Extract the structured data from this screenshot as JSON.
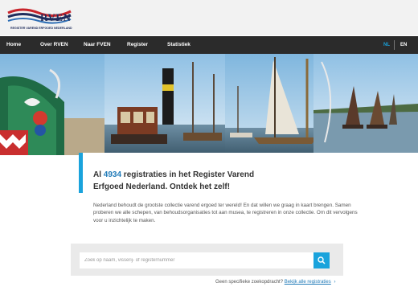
{
  "logo": {
    "wordmark": "RVEN",
    "subtitle": "REGISTER VAREND ERFGOED NEDERLAND"
  },
  "nav": {
    "items": [
      {
        "label": "Home"
      },
      {
        "label": "Over RVEN"
      },
      {
        "label": "Naar FVEN"
      },
      {
        "label": "Register"
      },
      {
        "label": "Statistiek"
      }
    ],
    "languages": [
      {
        "label": "NL",
        "active": true
      },
      {
        "label": "EN",
        "active": false
      }
    ]
  },
  "hero": {
    "panels": [
      "painted-boat-bow",
      "steam-tug-harbor",
      "sailboat-harbor",
      "sailboats-lake"
    ]
  },
  "intro": {
    "headline_prefix": "Al ",
    "registrations_count": "4934",
    "headline_line1_rest": " registraties in het Register Varend",
    "headline_line2": "Erfgoed Nederland. Ontdek het zelf!",
    "body": "Nederland behoudt de grootste collectie varend ergoed ter wereld! En dat willen we graag in kaart brengen. Samen proberen we alle schepen, van behoudsorganisaties tot aan musea, te registreren in onze collectie. Om dit vervolgens voor u inzichtelijk te maken."
  },
  "search": {
    "placeholder": "Zoek op naam, visserij- of registernummer",
    "button_icon": "search-icon"
  },
  "footer": {
    "prompt": "Geen specifieke zoekopdracht?",
    "link": "Bekijk alle registraties",
    "chevron": "›"
  },
  "colors": {
    "accent": "#1aa3dc",
    "nav_bg": "#2b2b2b",
    "link": "#1f7ab8",
    "brand": "#1f2d5c",
    "lang_active": "#1aa3dc"
  }
}
